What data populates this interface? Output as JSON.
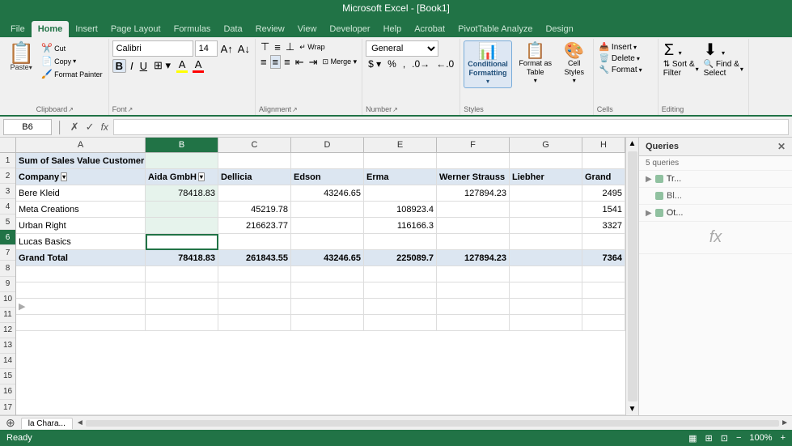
{
  "app": {
    "title": "Microsoft Excel - [Book1]"
  },
  "tabs": [
    {
      "label": "File",
      "active": false
    },
    {
      "label": "Home",
      "active": true
    },
    {
      "label": "Insert",
      "active": false
    },
    {
      "label": "Page Layout",
      "active": false
    },
    {
      "label": "Formulas",
      "active": false
    },
    {
      "label": "Data",
      "active": false
    },
    {
      "label": "Review",
      "active": false
    },
    {
      "label": "View",
      "active": false
    },
    {
      "label": "Developer",
      "active": false
    },
    {
      "label": "Help",
      "active": false
    },
    {
      "label": "Acrobat",
      "active": false
    },
    {
      "label": "PivotTable Analyze",
      "active": false
    },
    {
      "label": "Design",
      "active": false
    }
  ],
  "ribbon": {
    "clipboard_label": "Clipboard",
    "font_label": "Font",
    "alignment_label": "Alignment",
    "number_label": "Number",
    "styles_label": "Styles",
    "cells_label": "Cells",
    "editing_label": "Editing",
    "font_name": "Calibri",
    "font_size": "14",
    "conditional_formatting": "Conditional Formatting",
    "format_as_table": "Format as Table",
    "cell_styles": "Cell Styles",
    "insert_label": "Insert",
    "delete_label": "Delete",
    "format_label": "Format",
    "sort_filter": "Sort & Filter",
    "find_select": "Find & Select"
  },
  "formula_bar": {
    "cell_ref": "B6",
    "formula": ""
  },
  "columns": [
    "A",
    "B",
    "C",
    "D",
    "E",
    "F",
    "G",
    "H"
  ],
  "rows": [
    {
      "num": 1,
      "cells": [
        "Sum of Sales Value  Customer",
        "",
        "",
        "",
        "",
        "",
        "",
        ""
      ]
    },
    {
      "num": 2,
      "cells": [
        "Company",
        "Aida GmbH",
        "Dellicia",
        "Edson",
        "Erma",
        "Werner Strauss",
        "Liebher",
        "Grand"
      ]
    },
    {
      "num": 3,
      "cells": [
        "Bere Kleid",
        "78418.83",
        "",
        "43246.65",
        "",
        "127894.23",
        "",
        "2495"
      ]
    },
    {
      "num": 4,
      "cells": [
        "Meta Creations",
        "",
        "45219.78",
        "",
        "108923.4",
        "",
        "",
        "1541"
      ]
    },
    {
      "num": 5,
      "cells": [
        "Urban Right",
        "",
        "216623.77",
        "",
        "116166.3",
        "",
        "",
        "3327"
      ]
    },
    {
      "num": 6,
      "cells": [
        "Lucas Basics",
        "",
        "",
        "",
        "",
        "",
        "",
        ""
      ]
    },
    {
      "num": 7,
      "cells": [
        "Grand Total",
        "78418.83",
        "261843.55",
        "43246.65",
        "225089.7",
        "127894.23",
        "",
        "7364"
      ]
    },
    {
      "num": 8,
      "cells": [
        "",
        "",
        "",
        "",
        "",
        "",
        "",
        ""
      ]
    },
    {
      "num": 9,
      "cells": [
        "",
        "",
        "",
        "",
        "",
        "",
        "",
        ""
      ]
    },
    {
      "num": 10,
      "cells": [
        "",
        "",
        "",
        "",
        "",
        "",
        "",
        ""
      ]
    },
    {
      "num": 11,
      "cells": [
        "",
        "",
        "",
        "",
        "",
        "",
        "",
        ""
      ]
    },
    {
      "num": 12,
      "cells": [
        "",
        "",
        "",
        "",
        "",
        "",
        "",
        ""
      ]
    },
    {
      "num": 13,
      "cells": [
        "",
        "",
        "",
        "",
        "",
        "",
        "",
        ""
      ]
    },
    {
      "num": 14,
      "cells": [
        "",
        "",
        "",
        "",
        "",
        "",
        "",
        ""
      ]
    },
    {
      "num": 15,
      "cells": [
        "",
        "",
        "",
        "",
        "",
        "",
        "",
        ""
      ]
    },
    {
      "num": 16,
      "cells": [
        "",
        "",
        "",
        "",
        "",
        "",
        "",
        ""
      ]
    },
    {
      "num": 17,
      "cells": [
        "",
        "",
        "",
        "",
        "",
        "",
        "",
        ""
      ]
    }
  ],
  "queries_panel": {
    "title": "Queries",
    "count_label": "5 queries",
    "items": [
      {
        "label": "Tr...",
        "type": "group",
        "expanded": true
      },
      {
        "label": "Bl...",
        "type": "sub"
      },
      {
        "label": "Ot...",
        "type": "group",
        "expanded": true
      }
    ]
  },
  "status_bar": {
    "sheet_tab": "la Chara...",
    "ready": ""
  }
}
